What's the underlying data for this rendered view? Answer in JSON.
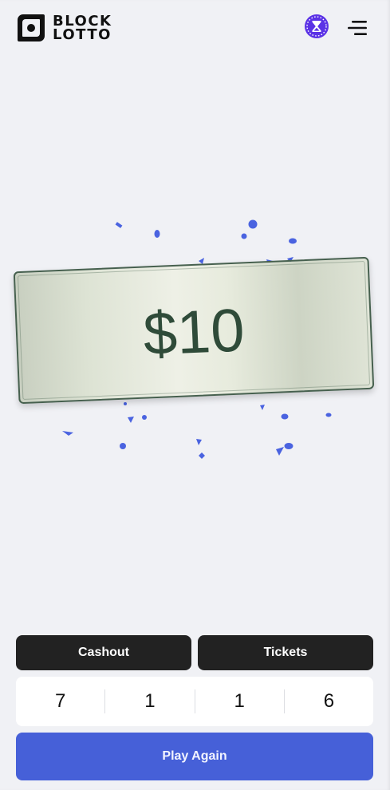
{
  "brand": {
    "line1": "BLOCK",
    "line2": "LOTTO",
    "logo_icon": "block-lotto-logo-icon"
  },
  "header": {
    "avatar_icon": "hourglass-avatar-icon",
    "menu_icon": "hamburger-menu-icon"
  },
  "prize": {
    "amount": "$10"
  },
  "actions": {
    "cashout_label": "Cashout",
    "tickets_label": "Tickets"
  },
  "drawn_numbers": [
    "7",
    "1",
    "1",
    "6"
  ],
  "play_again_label": "Play Again",
  "colors": {
    "background": "#f0f1f5",
    "accent": "#4660d8",
    "confetti": "#4a63e0",
    "dark_button": "#222222",
    "bill_ink": "#2f4b39",
    "bill_border": "#46604e",
    "avatar": "#5b32e6"
  }
}
